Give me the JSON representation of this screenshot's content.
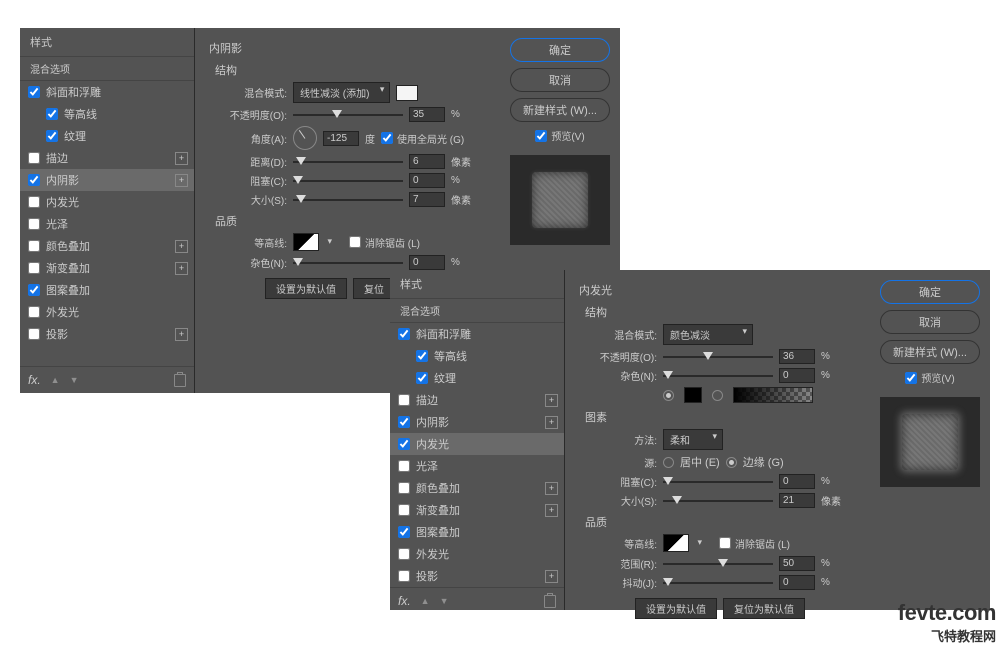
{
  "dialog1": {
    "title": "样式",
    "subtitle": "混合选项",
    "styles": [
      {
        "label": "斜面和浮雕",
        "checked": true,
        "plus": false
      },
      {
        "label": "等高线",
        "checked": true,
        "plus": false,
        "indent": true
      },
      {
        "label": "纹理",
        "checked": true,
        "plus": false,
        "indent": true
      },
      {
        "label": "描边",
        "checked": false,
        "plus": true
      },
      {
        "label": "内阴影",
        "checked": true,
        "plus": true,
        "selected": true
      },
      {
        "label": "内发光",
        "checked": false,
        "plus": false
      },
      {
        "label": "光泽",
        "checked": false,
        "plus": false
      },
      {
        "label": "颜色叠加",
        "checked": false,
        "plus": true
      },
      {
        "label": "渐变叠加",
        "checked": false,
        "plus": true
      },
      {
        "label": "图案叠加",
        "checked": true,
        "plus": false
      },
      {
        "label": "外发光",
        "checked": false,
        "plus": false
      },
      {
        "label": "投影",
        "checked": false,
        "plus": true
      }
    ],
    "fx": "fx.",
    "main": {
      "title": "内阴影",
      "section1": "结构",
      "blend_label": "混合模式:",
      "blend_value": "线性减淡 (添加)",
      "opacity_label": "不透明度(O):",
      "opacity_value": "35",
      "percent": "%",
      "angle_label": "角度(A):",
      "angle_value": "-125",
      "angle_unit": "度",
      "global_light": "使用全局光 (G)",
      "distance_label": "距离(D):",
      "distance_value": "6",
      "px": "像素",
      "choke_label": "阻塞(C):",
      "choke_value": "0",
      "size_label": "大小(S):",
      "size_value": "7",
      "section2": "品质",
      "contour_label": "等高线:",
      "antialias": "消除锯齿 (L)",
      "noise_label": "杂色(N):",
      "noise_value": "0",
      "default_btn": "设置为默认值",
      "reset_btn": "复位"
    },
    "right": {
      "ok": "确定",
      "cancel": "取消",
      "new_style": "新建样式 (W)...",
      "preview": "预览(V)"
    }
  },
  "dialog2": {
    "title": "样式",
    "subtitle": "混合选项",
    "styles": [
      {
        "label": "斜面和浮雕",
        "checked": true,
        "plus": false
      },
      {
        "label": "等高线",
        "checked": true,
        "plus": false,
        "indent": true
      },
      {
        "label": "纹理",
        "checked": true,
        "plus": false,
        "indent": true
      },
      {
        "label": "描边",
        "checked": false,
        "plus": true
      },
      {
        "label": "内阴影",
        "checked": true,
        "plus": true
      },
      {
        "label": "内发光",
        "checked": true,
        "plus": false,
        "selected": true
      },
      {
        "label": "光泽",
        "checked": false,
        "plus": false
      },
      {
        "label": "颜色叠加",
        "checked": false,
        "plus": true
      },
      {
        "label": "渐变叠加",
        "checked": false,
        "plus": true
      },
      {
        "label": "图案叠加",
        "checked": true,
        "plus": false
      },
      {
        "label": "外发光",
        "checked": false,
        "plus": false
      },
      {
        "label": "投影",
        "checked": false,
        "plus": true
      }
    ],
    "fx": "fx.",
    "main": {
      "title": "内发光",
      "section1": "结构",
      "blend_label": "混合模式:",
      "blend_value": "颜色减淡",
      "opacity_label": "不透明度(O):",
      "opacity_value": "36",
      "percent": "%",
      "noise_label": "杂色(N):",
      "noise_value": "0",
      "section2": "图素",
      "method_label": "方法:",
      "method_value": "柔和",
      "source_label": "源:",
      "center": "居中 (E)",
      "edge": "边缘 (G)",
      "choke_label": "阻塞(C):",
      "choke_value": "0",
      "size_label": "大小(S):",
      "size_value": "21",
      "px": "像素",
      "section3": "品质",
      "contour_label": "等高线:",
      "antialias": "消除锯齿 (L)",
      "range_label": "范围(R):",
      "range_value": "50",
      "jitter_label": "抖动(J):",
      "jitter_value": "0",
      "default_btn": "设置为默认值",
      "reset_btn": "复位为默认值"
    },
    "right": {
      "ok": "确定",
      "cancel": "取消",
      "new_style": "新建样式 (W)...",
      "preview": "预览(V)"
    }
  },
  "watermark": {
    "line1": "fevte.com",
    "line2": "飞特教程网"
  }
}
